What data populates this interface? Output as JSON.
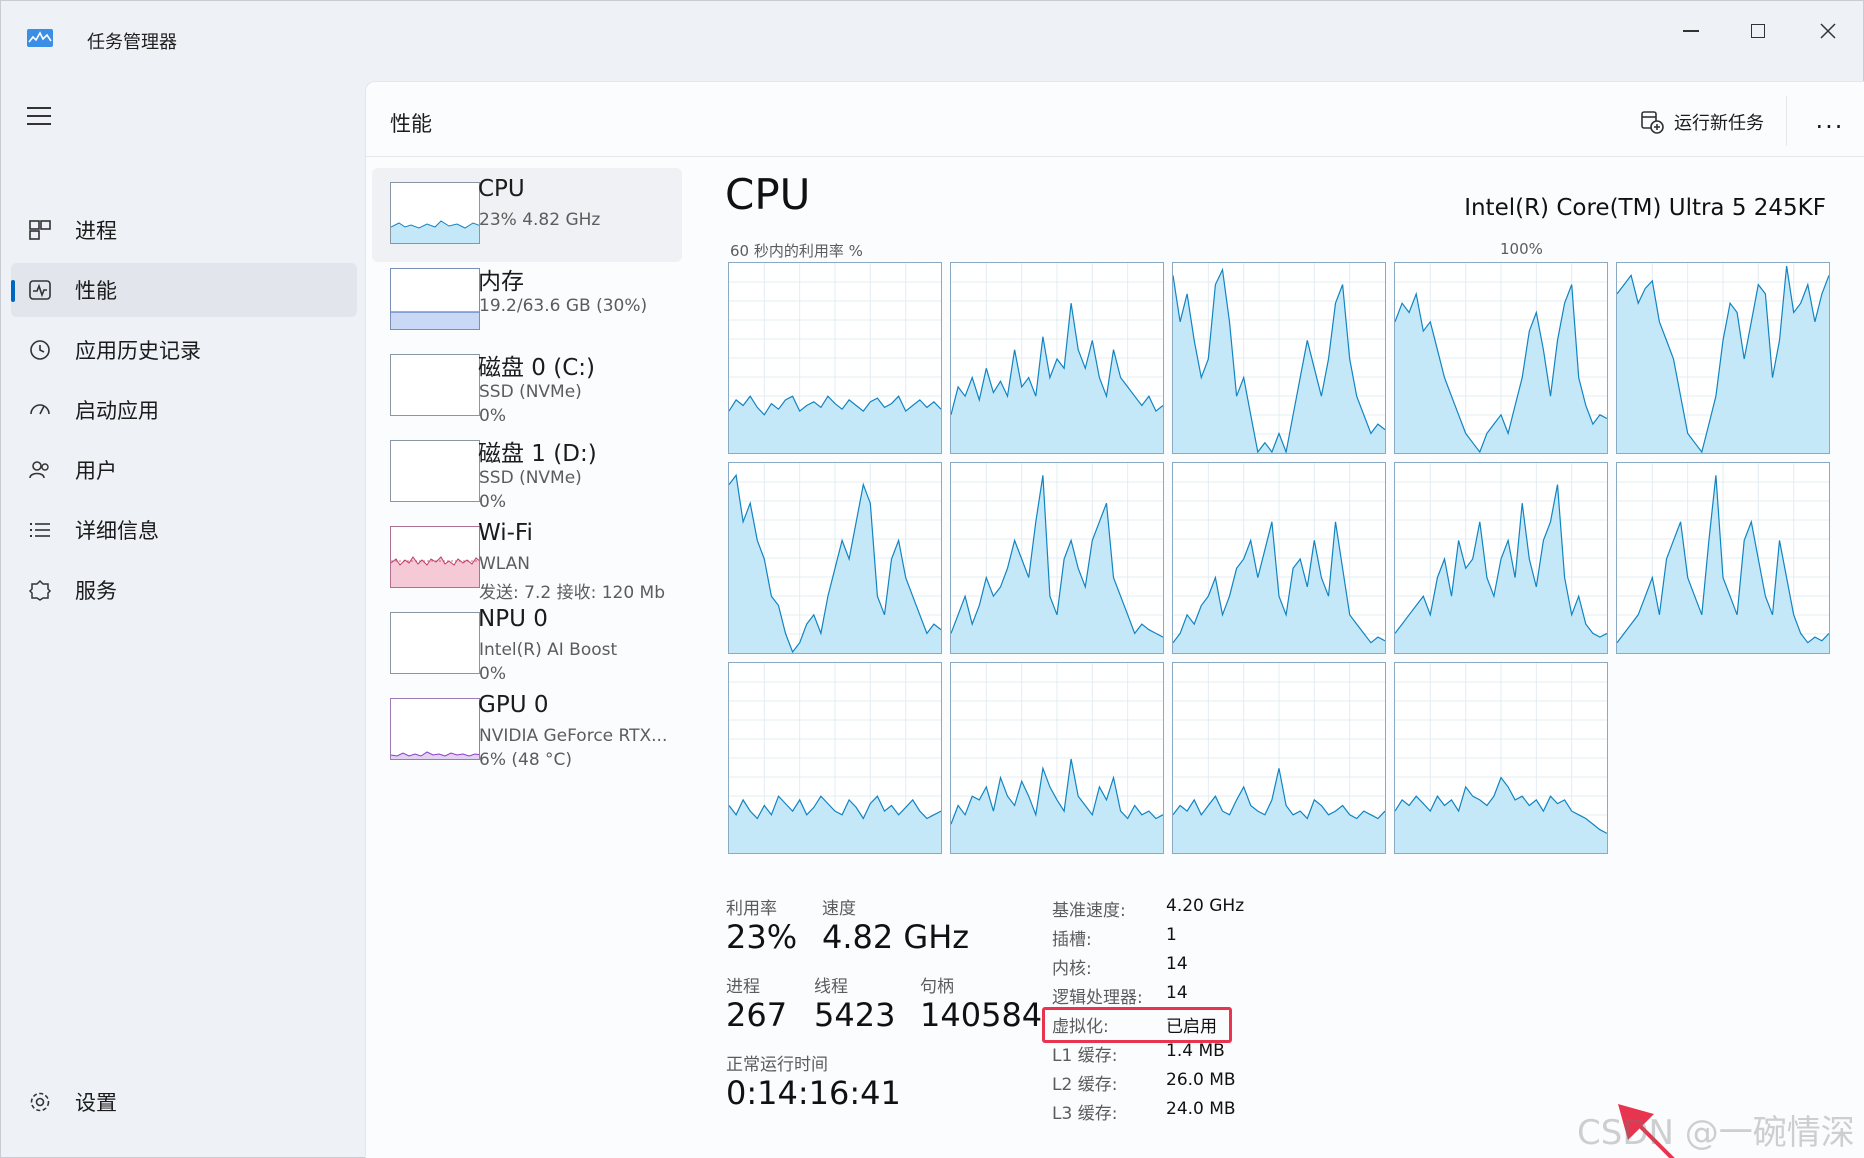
{
  "window": {
    "title": "任务管理器",
    "page_title": "性能",
    "run_task_label": "运行新任务",
    "more_label": "..."
  },
  "sidebar": {
    "items": [
      {
        "label": "进程",
        "icon": "grid-icon"
      },
      {
        "label": "性能",
        "icon": "performance-icon"
      },
      {
        "label": "应用历史记录",
        "icon": "history-icon"
      },
      {
        "label": "启动应用",
        "icon": "startup-icon"
      },
      {
        "label": "用户",
        "icon": "users-icon"
      },
      {
        "label": "详细信息",
        "icon": "details-list-icon"
      },
      {
        "label": "服务",
        "icon": "services-icon"
      }
    ],
    "settings_label": "设置"
  },
  "devices": [
    {
      "name": "CPU",
      "sub1": "23%  4.82 GHz",
      "sub2": ""
    },
    {
      "name": "内存",
      "sub1": "19.2/63.6 GB (30%)",
      "sub2": ""
    },
    {
      "name": "磁盘 0 (C:)",
      "sub1": "SSD (NVMe)",
      "sub2": "0%"
    },
    {
      "name": "磁盘 1 (D:)",
      "sub1": "SSD (NVMe)",
      "sub2": "0%"
    },
    {
      "name": "Wi-Fi",
      "sub1": "WLAN",
      "sub2": "发送: 7.2  接收: 120 Mb"
    },
    {
      "name": "NPU 0",
      "sub1": "Intel(R) AI Boost",
      "sub2": "0%"
    },
    {
      "name": "GPU 0",
      "sub1": "NVIDIA GeForce RTX...",
      "sub2": "6% (48 °C)"
    }
  ],
  "cpu": {
    "title": "CPU",
    "model": "Intel(R) Core(TM) Ultra 5 245KF",
    "graph_label": "60 秒内的利用率 %",
    "max_label": "100%",
    "colors": {
      "line": "#1184c2",
      "fill": "#c4e8f7",
      "grid": "#e3ecf3"
    },
    "cores": [
      [
        22,
        28,
        25,
        30,
        24,
        20,
        26,
        23,
        28,
        30,
        22,
        25,
        27,
        24,
        30,
        26,
        23,
        28,
        25,
        22,
        27,
        29,
        24,
        26,
        30,
        22,
        25,
        28,
        24,
        27,
        23
      ],
      [
        20,
        35,
        30,
        40,
        28,
        45,
        32,
        38,
        30,
        55,
        35,
        40,
        30,
        62,
        40,
        50,
        45,
        80,
        55,
        45,
        60,
        40,
        30,
        55,
        40,
        35,
        30,
        25,
        30,
        22,
        25
      ],
      [
        95,
        70,
        85,
        60,
        40,
        50,
        90,
        98,
        70,
        30,
        40,
        20,
        0,
        5,
        0,
        10,
        0,
        20,
        40,
        60,
        45,
        30,
        50,
        80,
        90,
        50,
        30,
        20,
        10,
        15,
        12
      ],
      [
        70,
        80,
        75,
        85,
        65,
        70,
        55,
        40,
        30,
        20,
        10,
        5,
        0,
        10,
        15,
        20,
        10,
        25,
        40,
        65,
        75,
        55,
        30,
        60,
        80,
        90,
        40,
        25,
        15,
        20,
        18
      ],
      [
        85,
        90,
        95,
        80,
        88,
        92,
        70,
        60,
        50,
        30,
        10,
        5,
        0,
        15,
        30,
        60,
        80,
        75,
        50,
        70,
        90,
        85,
        40,
        60,
        100,
        75,
        80,
        90,
        70,
        85,
        95
      ],
      [
        90,
        95,
        70,
        80,
        60,
        50,
        30,
        25,
        10,
        0,
        5,
        15,
        20,
        10,
        30,
        45,
        60,
        50,
        70,
        90,
        80,
        30,
        20,
        50,
        60,
        40,
        30,
        20,
        10,
        15,
        12
      ],
      [
        10,
        20,
        30,
        15,
        25,
        40,
        30,
        35,
        45,
        60,
        50,
        40,
        70,
        95,
        30,
        20,
        50,
        60,
        45,
        35,
        60,
        70,
        80,
        40,
        30,
        20,
        10,
        15,
        12,
        10,
        8
      ],
      [
        5,
        10,
        20,
        15,
        25,
        30,
        40,
        20,
        30,
        45,
        50,
        60,
        40,
        55,
        70,
        30,
        20,
        45,
        50,
        35,
        60,
        40,
        30,
        70,
        45,
        20,
        15,
        10,
        5,
        8,
        6
      ],
      [
        10,
        15,
        20,
        25,
        30,
        20,
        40,
        50,
        30,
        60,
        45,
        50,
        70,
        40,
        30,
        50,
        60,
        40,
        80,
        50,
        35,
        60,
        70,
        90,
        40,
        20,
        30,
        15,
        10,
        8,
        10
      ],
      [
        5,
        10,
        15,
        20,
        30,
        40,
        20,
        50,
        60,
        70,
        40,
        30,
        20,
        60,
        95,
        40,
        30,
        20,
        60,
        70,
        50,
        30,
        20,
        60,
        40,
        20,
        10,
        5,
        8,
        6,
        10
      ]
    ],
    "cores_low": [
      [
        25,
        20,
        28,
        22,
        18,
        25,
        20,
        30,
        26,
        22,
        28,
        20,
        24,
        30,
        26,
        22,
        20,
        28,
        24,
        18,
        26,
        30,
        22,
        25,
        20,
        24,
        28,
        22,
        18,
        20,
        22
      ],
      [
        15,
        25,
        20,
        30,
        28,
        35,
        22,
        40,
        30,
        25,
        38,
        30,
        20,
        45,
        35,
        28,
        22,
        50,
        30,
        25,
        20,
        35,
        28,
        40,
        22,
        18,
        25,
        20,
        22,
        18,
        20
      ],
      [
        20,
        25,
        22,
        28,
        20,
        25,
        30,
        22,
        20,
        28,
        35,
        25,
        22,
        20,
        28,
        45,
        25,
        20,
        22,
        18,
        28,
        25,
        20,
        22,
        25,
        20,
        18,
        22,
        20,
        18,
        22
      ],
      [
        22,
        28,
        25,
        30,
        26,
        22,
        30,
        25,
        28,
        22,
        35,
        30,
        28,
        25,
        30,
        40,
        35,
        28,
        30,
        25,
        28,
        22,
        30,
        26,
        28,
        22,
        20,
        18,
        15,
        12,
        10
      ]
    ]
  },
  "stats": {
    "util_label": "利用率",
    "util_value": "23%",
    "speed_label": "速度",
    "speed_value": "4.82 GHz",
    "proc_label": "进程",
    "proc_value": "267",
    "thread_label": "线程",
    "thread_value": "5423",
    "handle_label": "句柄",
    "handle_value": "140584",
    "uptime_label": "正常运行时间",
    "uptime_value": "0:14:16:41"
  },
  "specs": [
    {
      "k": "基准速度:",
      "v": "4.20 GHz"
    },
    {
      "k": "插槽:",
      "v": "1"
    },
    {
      "k": "内核:",
      "v": "14"
    },
    {
      "k": "逻辑处理器:",
      "v": "14"
    },
    {
      "k": "虚拟化:",
      "v": "已启用"
    },
    {
      "k": "L1 缓存:",
      "v": "1.4 MB"
    },
    {
      "k": "L2 缓存:",
      "v": "26.0 MB"
    },
    {
      "k": "L3 缓存:",
      "v": "24.0 MB"
    }
  ],
  "annotation_color": "#e8344f",
  "watermark": "CSDN @一碗情深"
}
